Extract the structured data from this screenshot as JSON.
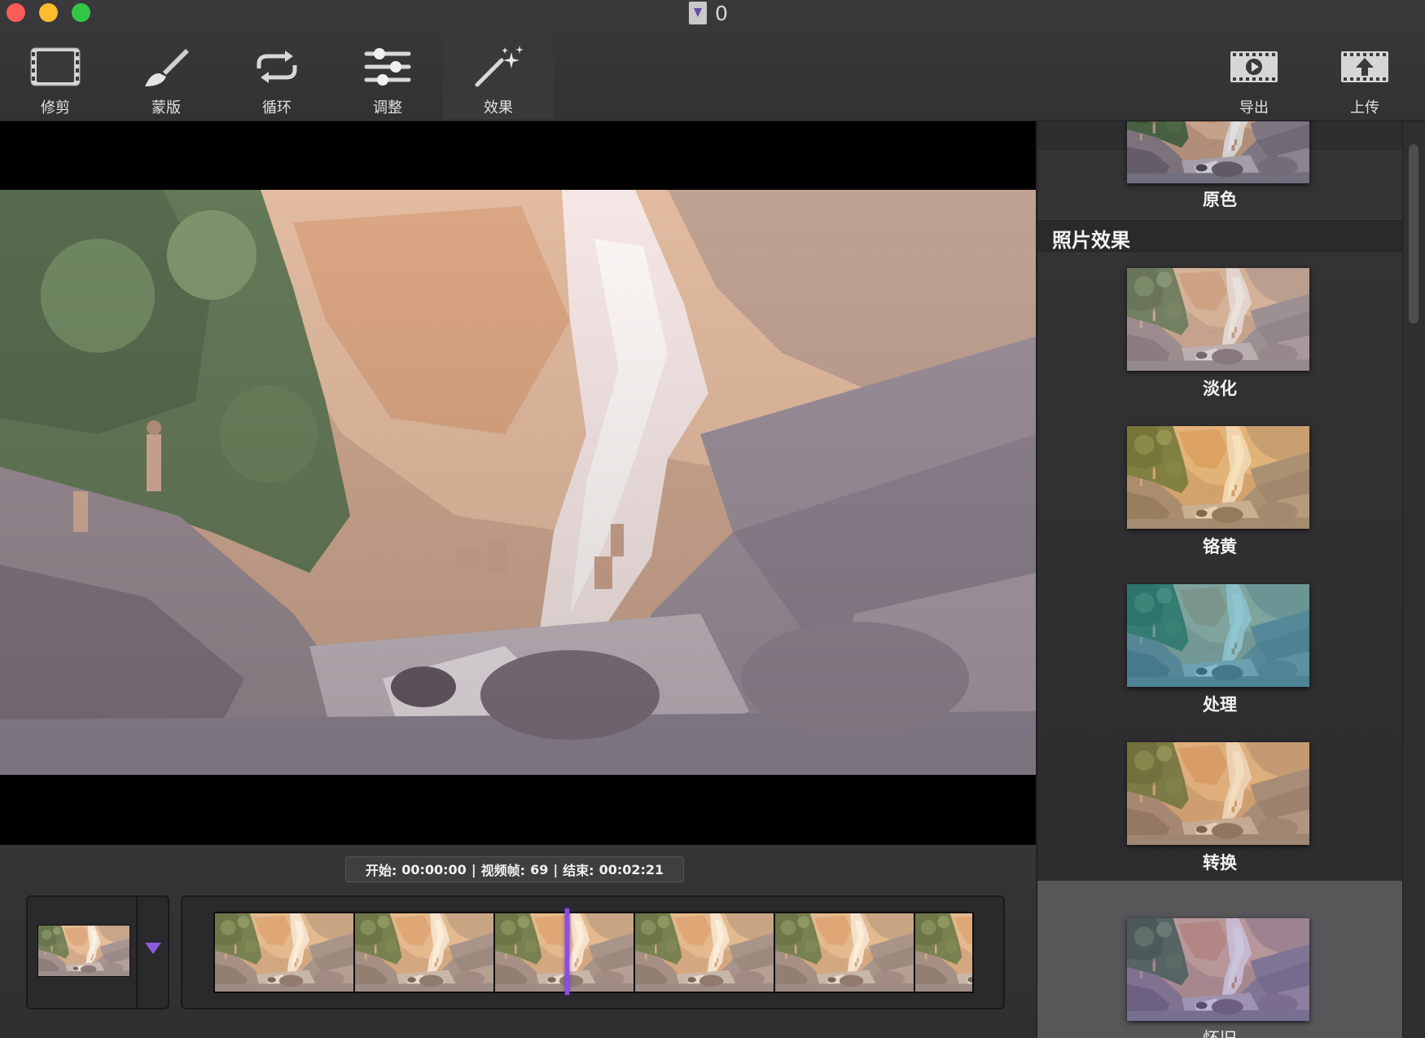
{
  "window": {
    "title": "0"
  },
  "toolbar": {
    "tools": [
      {
        "label": "修剪",
        "icon": "film-trim-icon"
      },
      {
        "label": "蒙版",
        "icon": "brush-icon"
      },
      {
        "label": "循环",
        "icon": "loop-icon"
      },
      {
        "label": "调整",
        "icon": "sliders-icon"
      },
      {
        "label": "效果",
        "icon": "magic-wand-icon",
        "active": true
      }
    ],
    "actions": [
      {
        "label": "导出",
        "icon": "export-film-icon"
      },
      {
        "label": "上传",
        "icon": "upload-film-icon"
      }
    ]
  },
  "timeline": {
    "start_label": "开始:",
    "start_value": "00:00:00",
    "frames_label": "视频帧:",
    "frames_value": "69",
    "end_label": "结束:",
    "end_value": "00:02:21",
    "separator": "|"
  },
  "effects_panel": {
    "section_title": "照片效果",
    "original_label": "原色",
    "effects": [
      {
        "name": "淡化",
        "tint": "faded"
      },
      {
        "name": "铬黄",
        "tint": "chrome"
      },
      {
        "name": "处理",
        "tint": "process"
      },
      {
        "name": "转换",
        "tint": "transfer"
      },
      {
        "name": "怀旧",
        "tint": "instant",
        "selected": true
      }
    ]
  },
  "colors": {
    "accent_purple": "#8b4fe0",
    "toolbar_bg": "#353436",
    "panel_bg": "#303031",
    "selected_bg": "#575659"
  }
}
